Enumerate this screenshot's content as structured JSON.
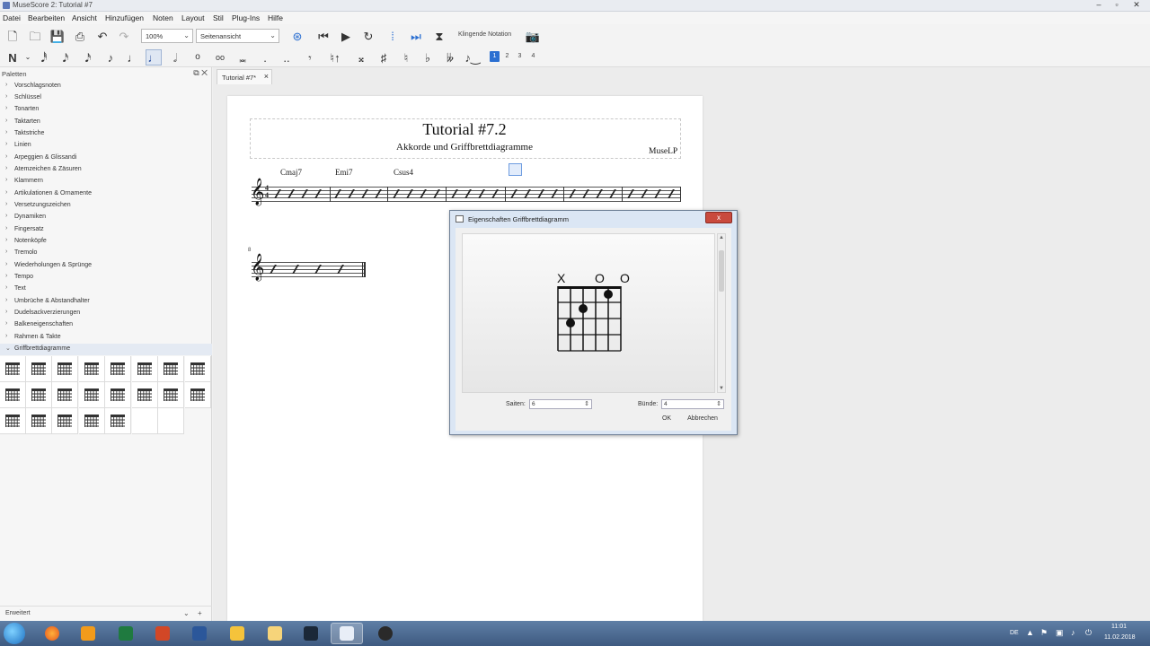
{
  "window": {
    "title": "MuseScore 2: Tutorial #7"
  },
  "menu": [
    "Datei",
    "Bearbeiten",
    "Ansicht",
    "Hinzufügen",
    "Noten",
    "Layout",
    "Stil",
    "Plug-Ins",
    "Hilfe"
  ],
  "toolbar": {
    "zoom_value": "100%",
    "view_mode": "Seitenansicht",
    "concert_pitch_label": "Klingende Notation",
    "voices": [
      "1",
      "2",
      "3",
      "4"
    ]
  },
  "palettes": {
    "header": "Paletten",
    "items": [
      "Vorschlagsnoten",
      "Schlüssel",
      "Tonarten",
      "Taktarten",
      "Taktstriche",
      "Linien",
      "Arpeggien & Glissandi",
      "Atemzeichen & Zäsuren",
      "Klammern",
      "Artikulationen & Ornamente",
      "Versetzungszeichen",
      "Dynamiken",
      "Fingersatz",
      "Notenköpfe",
      "Tremolo",
      "Wiederholungen & Sprünge",
      "Tempo",
      "Text",
      "Umbrüche & Abstandhalter",
      "Dudelsackverzierungen",
      "Balkeneigenschaften",
      "Rahmen & Takte",
      "Griffbrettdiagramme"
    ],
    "footer_mode": "Erweitert"
  },
  "score": {
    "tab_label": "Tutorial #7*",
    "title": "Tutorial #7.2",
    "subtitle": "Akkorde und Griffbrettdiagramme",
    "composer": "MuseLP",
    "chords": [
      "Cmaj7",
      "Emi7",
      "Csus4"
    ],
    "measure_number": "8"
  },
  "dialog": {
    "title": "Eigenschaften Griffbrettdiagramm",
    "close_label": "x",
    "string_markers": [
      "X",
      "O",
      "O"
    ],
    "strings_label": "Saiten:",
    "strings_value": "6",
    "frets_label": "Bünde:",
    "frets_value": "4",
    "ok_label": "OK",
    "cancel_label": "Abbrechen"
  },
  "taskbar": {
    "language": "DE",
    "time": "11:01",
    "date": "11.02.2018"
  }
}
